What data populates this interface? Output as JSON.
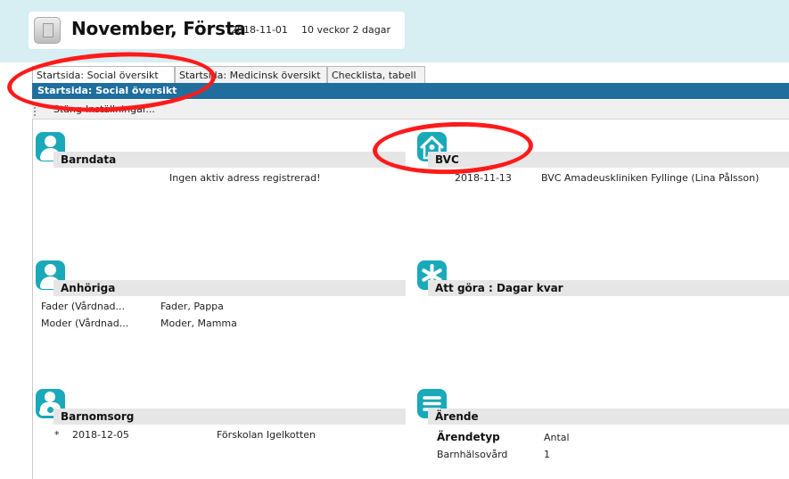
{
  "patient": {
    "name": "November, Första",
    "birthdate": "2018-11-01",
    "age": "10 veckor 2 dagar"
  },
  "tabs": [
    {
      "label": "Startsida: Social översikt",
      "active": true
    },
    {
      "label": "Startsida: Medicinsk översikt",
      "active": false
    },
    {
      "label": "Checklista, tabell",
      "active": false
    }
  ],
  "panel_title": "Startsida: Social översikt",
  "toolbar": {
    "close_label": "Stäng",
    "settings_label": "Inställningar..."
  },
  "sections": {
    "barndata": {
      "title": "Barndata",
      "message": "Ingen aktiv adress registrerad!",
      "icon": "person-icon"
    },
    "bvc": {
      "title": "BVC",
      "date": "2018-11-13",
      "clinic": "BVC Amadeuskliniken Fyllinge (Lina Pålsson)",
      "icon": "clinic-icon"
    },
    "anhoriga": {
      "title": "Anhöriga",
      "icon": "person-icon",
      "rows": [
        {
          "role": "Fader (Vårdnad...",
          "name": "Fader, Pappa"
        },
        {
          "role": "Moder (Vårdnad...",
          "name": "Moder, Mamma"
        }
      ]
    },
    "attgora": {
      "title": "Att göra : Dagar kvar",
      "icon": "asterisk-icon"
    },
    "barnomsorg": {
      "title": "Barnomsorg",
      "icon": "caregiver-icon",
      "rows": [
        {
          "marker": "*",
          "date": "2018-12-05",
          "place": "Förskolan Igelkotten"
        }
      ]
    },
    "arende": {
      "title": "Ärende",
      "icon": "list-icon",
      "col_type": "Ärendetyp",
      "col_count": "Antal",
      "rows": [
        {
          "type": "Barnhälsovård",
          "count": "1"
        }
      ]
    }
  },
  "colors": {
    "accent_teal": "#1aa9b9",
    "header_blue": "#1f6e9e",
    "annotation_red": "#ff1a1a"
  }
}
